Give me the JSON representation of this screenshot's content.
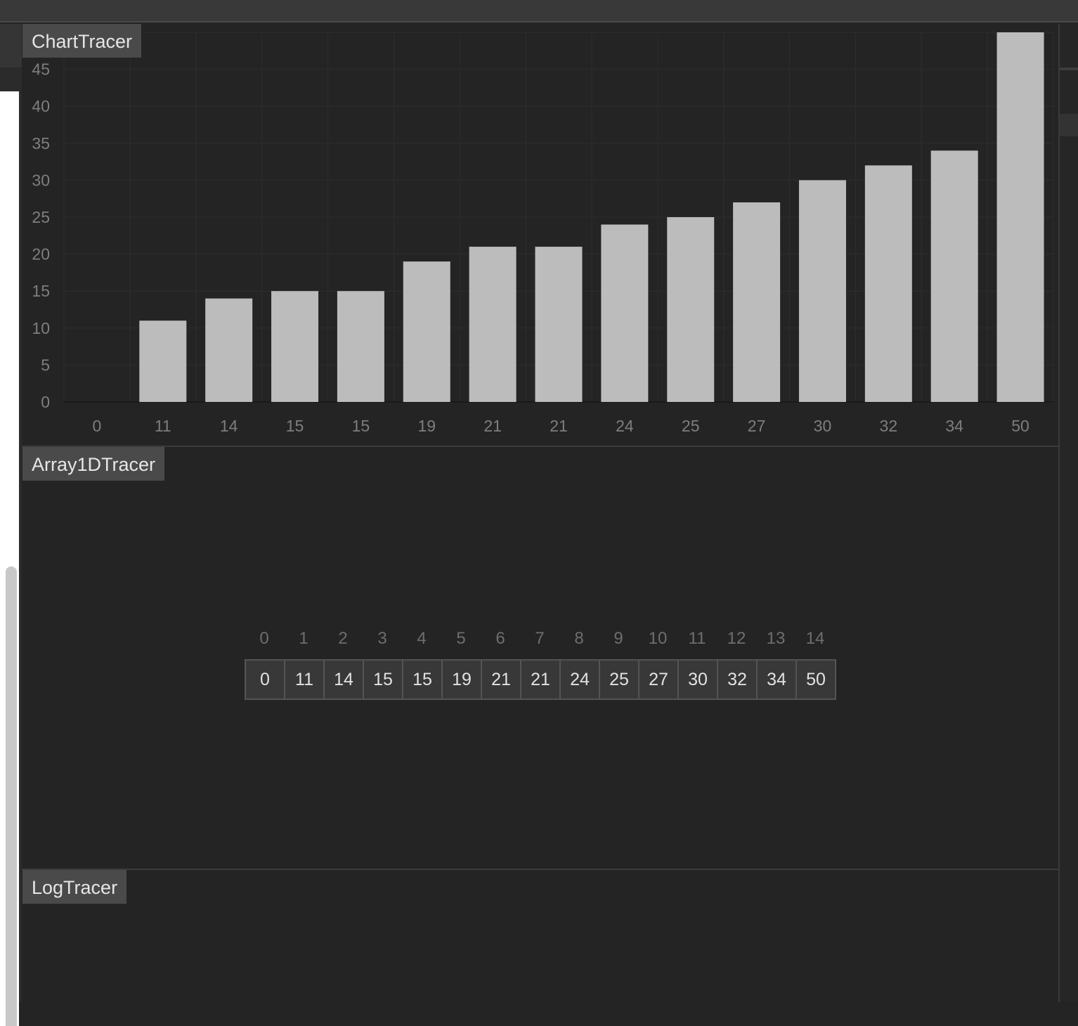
{
  "panels": {
    "chart_title": "ChartTracer",
    "array_title": "Array1DTracer",
    "log_title": "LogTracer"
  },
  "chart_data": {
    "type": "bar",
    "title": "",
    "xlabel": "",
    "ylabel": "",
    "categories": [
      "0",
      "11",
      "14",
      "15",
      "15",
      "19",
      "21",
      "21",
      "24",
      "25",
      "27",
      "30",
      "32",
      "34",
      "50"
    ],
    "values": [
      0,
      11,
      14,
      15,
      15,
      19,
      21,
      21,
      24,
      25,
      27,
      30,
      32,
      34,
      50
    ],
    "ylim": [
      0,
      50
    ],
    "yticks": [
      0,
      5,
      10,
      15,
      20,
      25,
      30,
      35,
      40,
      45
    ],
    "grid": true,
    "bar_color": "#bcbcbc"
  },
  "array": {
    "indices": [
      "0",
      "1",
      "2",
      "3",
      "4",
      "5",
      "6",
      "7",
      "8",
      "9",
      "10",
      "11",
      "12",
      "13",
      "14"
    ],
    "values": [
      "0",
      "11",
      "14",
      "15",
      "15",
      "19",
      "21",
      "21",
      "24",
      "25",
      "27",
      "30",
      "32",
      "34",
      "50"
    ]
  }
}
